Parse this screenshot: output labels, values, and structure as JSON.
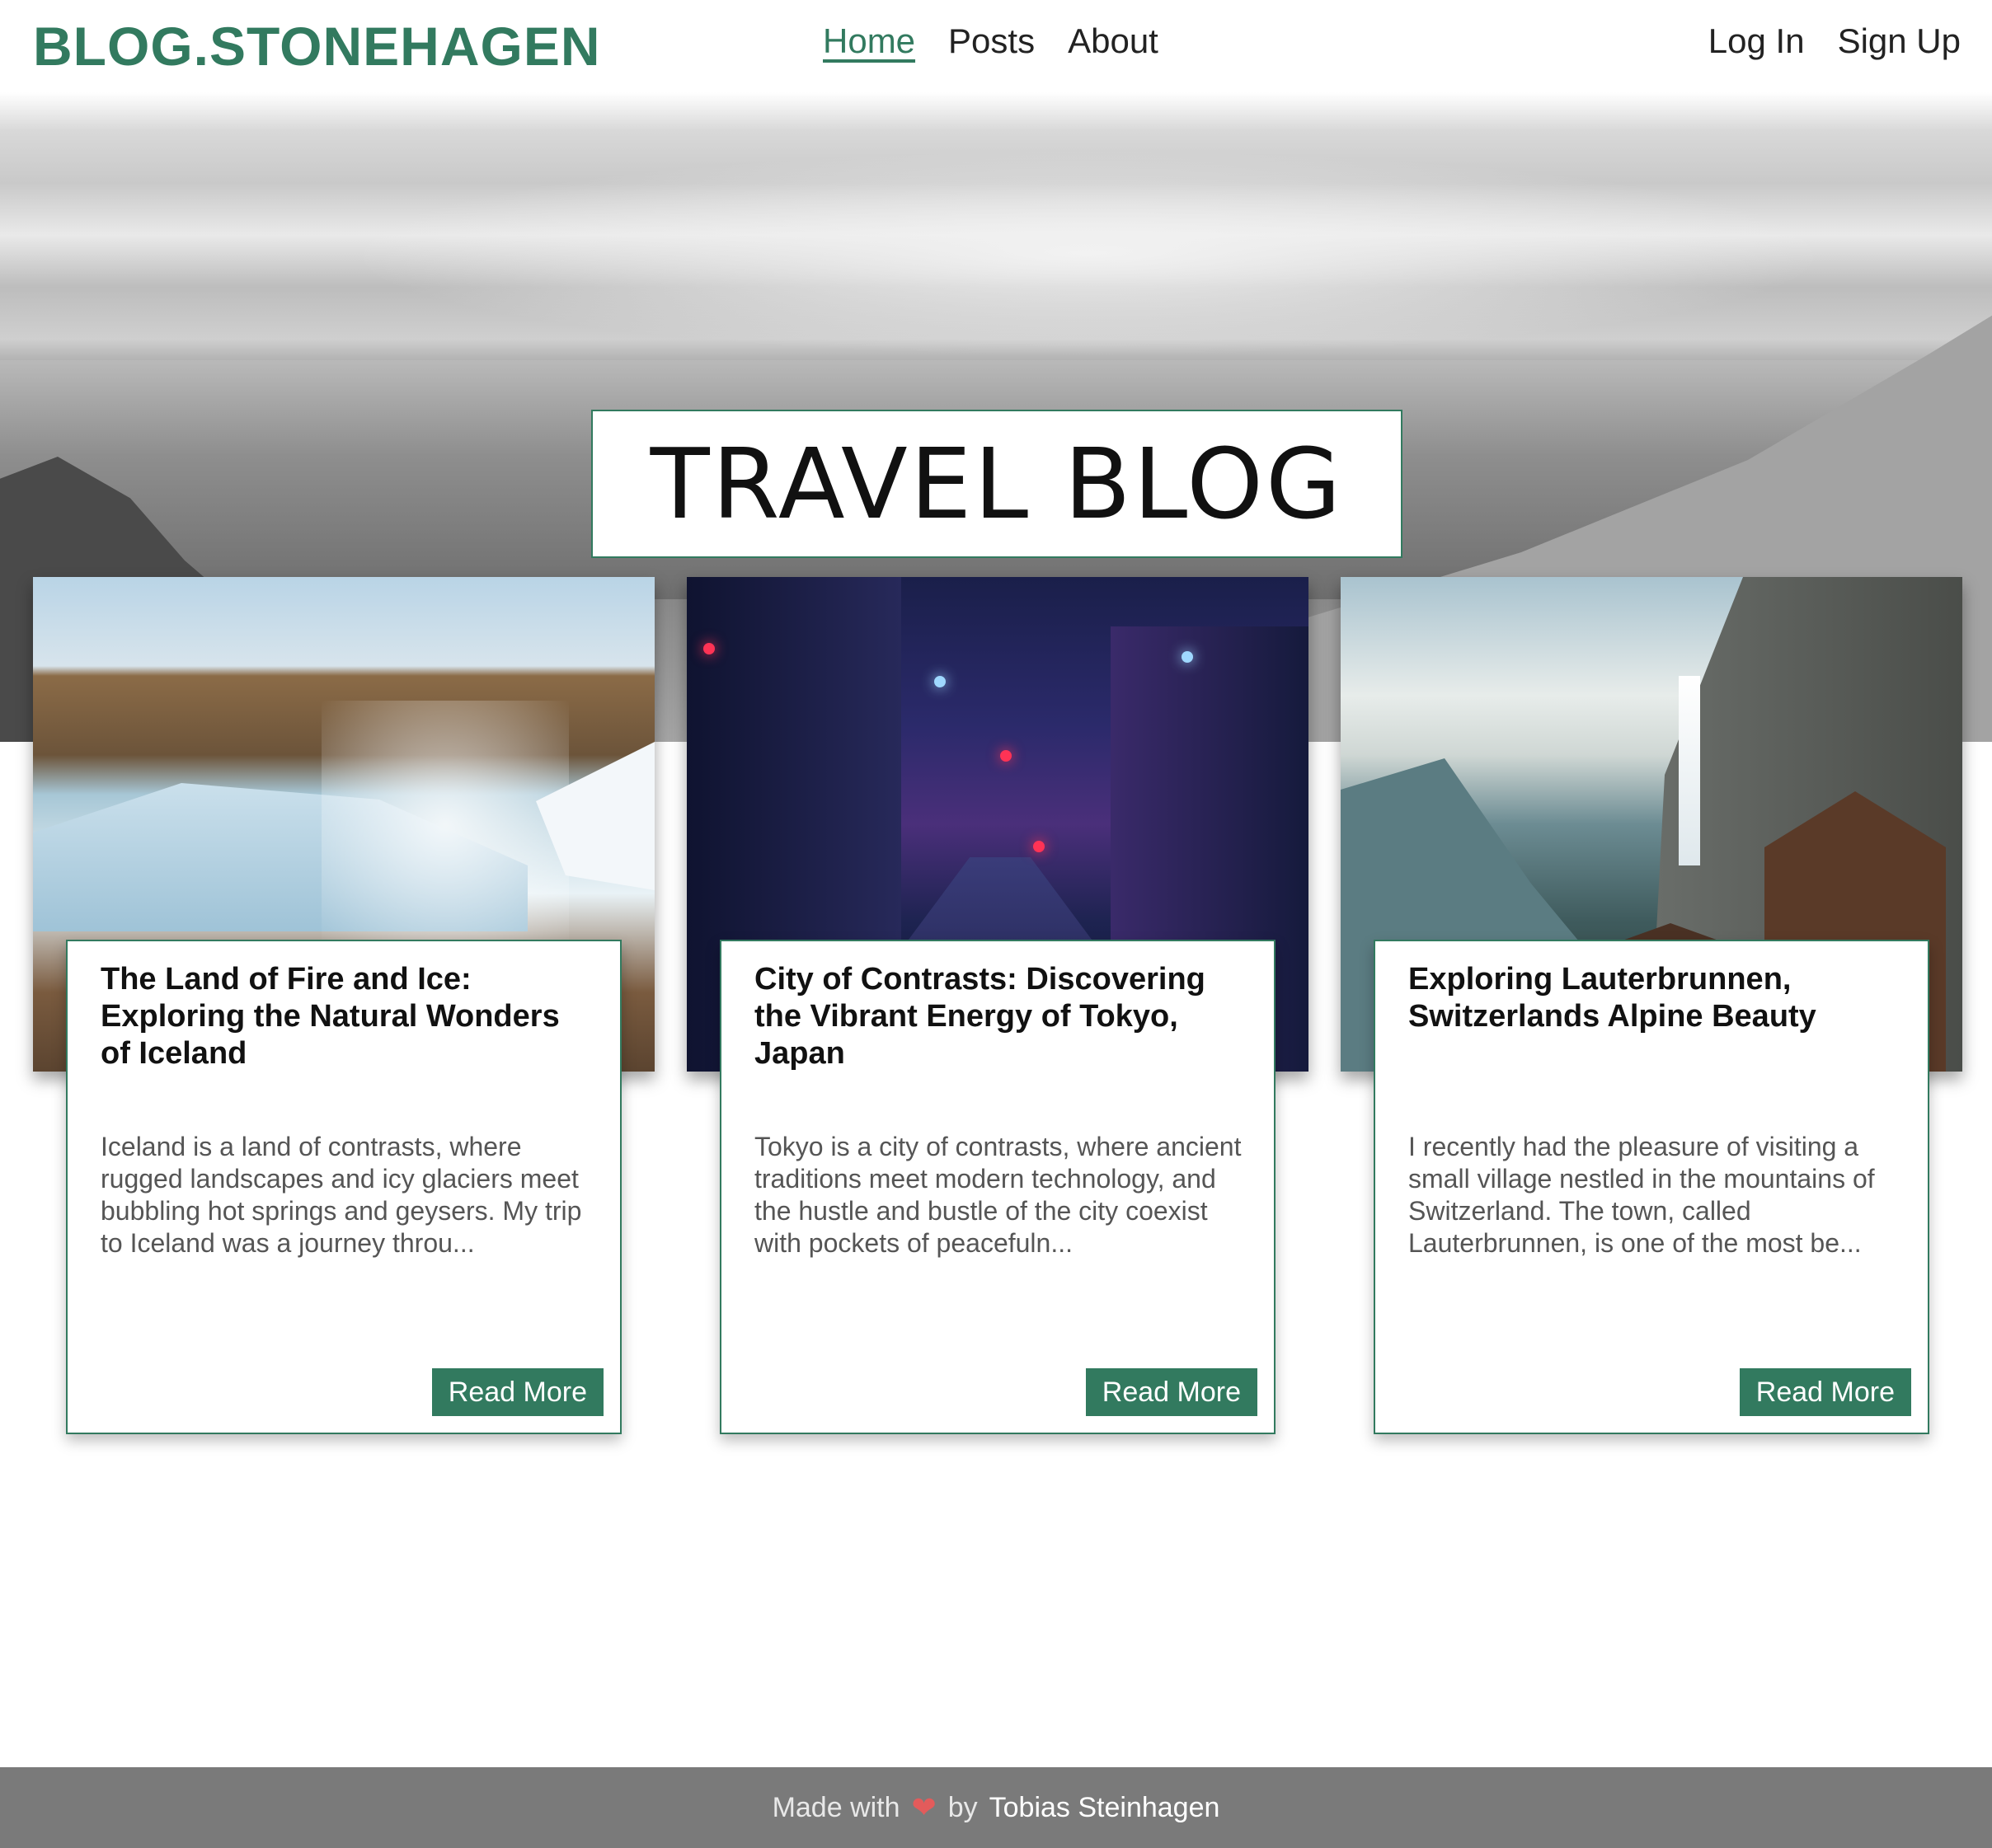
{
  "header": {
    "brand": "BLOG.STONEHAGEN",
    "nav": [
      {
        "label": "Home",
        "active": true
      },
      {
        "label": "Posts",
        "active": false
      },
      {
        "label": "About",
        "active": false
      }
    ],
    "auth": {
      "login": "Log In",
      "signup": "Sign Up"
    }
  },
  "hero": {
    "title": "TRAVEL BLOG"
  },
  "posts": [
    {
      "title": "The Land of Fire and Ice: Exploring the Natural Wonders of Iceland",
      "excerpt": "Iceland is a land of contrasts, where rugged landscapes and icy glaciers meet bubbling hot springs and geysers. My trip to Iceland was a journey throu...",
      "button": "Read More",
      "image": "iceland-waterfall-photo"
    },
    {
      "title": "City of Contrasts: Discovering the Vibrant Energy of Tokyo, Japan",
      "excerpt": "Tokyo is a city of contrasts, where ancient traditions meet modern technology, and the hustle and bustle of the city coexist with pockets of peacefuln...",
      "button": "Read More",
      "image": "tokyo-night-street-photo"
    },
    {
      "title": "Exploring Lauterbrunnen, Switzerlands Alpine Beauty",
      "excerpt": "I recently had the pleasure of visiting a small village nestled in the mountains of Switzerland. The town, called Lauterbrunnen, is one of the most be...",
      "button": "Read More",
      "image": "lauterbrunnen-valley-photo"
    }
  ],
  "footer": {
    "made_with": "Made with",
    "heart": "❤",
    "by": "by",
    "author": "Tobias Steinhagen"
  },
  "colors": {
    "accent": "#327a5f",
    "footer_bg": "#7a7a7a",
    "heart": "#e35b5b"
  }
}
